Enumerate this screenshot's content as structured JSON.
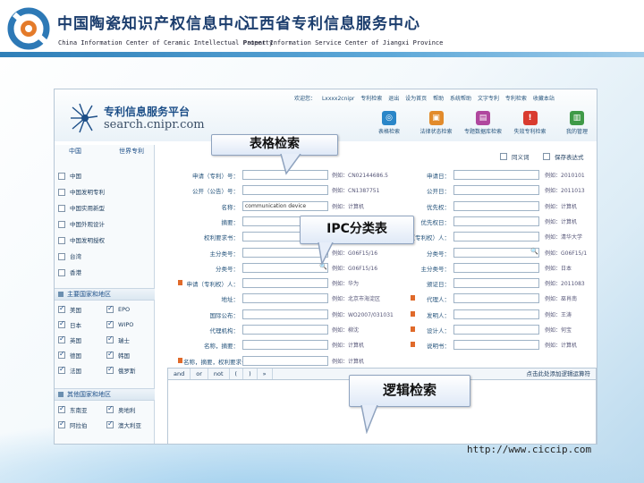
{
  "header": {
    "org1_cn": "中国陶瓷知识产权信息中心",
    "org1_en": "China Information Center of Ceramic Intellectual Property",
    "org2_cn": "江西省专利信息服务中心",
    "org2_en": "Patent Information Service Center of Jiangxi Province"
  },
  "site": {
    "title": "专利信息服务平台",
    "url": "search.cnipr.com",
    "top_links": [
      "欢迎您：",
      "Lxxxx2cnipr",
      "专利检索",
      "退出",
      "设为首页",
      "帮助",
      "系统帮助",
      "文字专利",
      "专利检索",
      "收藏本站"
    ],
    "tools": [
      {
        "label": "表格检索",
        "color": "#2a86c8",
        "glyph": "◎"
      },
      {
        "label": "法律状态检索",
        "color": "#e28b2c",
        "glyph": "▣"
      },
      {
        "label": "专题数据库检索",
        "color": "#b0479e",
        "glyph": "▤"
      },
      {
        "label": "失效专利检索",
        "color": "#d93b2f",
        "glyph": "!"
      },
      {
        "label": "我的管理",
        "color": "#3f9a48",
        "glyph": "▥"
      }
    ]
  },
  "left_panel": {
    "tab1": "中国",
    "tab2": "世界专利",
    "cn_dbs": [
      {
        "label": "中国",
        "checked": false
      },
      {
        "label": "中国发明专利",
        "checked": false
      },
      {
        "label": "中国实用新型",
        "checked": false
      },
      {
        "label": "中国外观设计",
        "checked": false
      },
      {
        "label": "中国发明授权",
        "checked": false
      },
      {
        "label": "台湾",
        "checked": false
      },
      {
        "label": "香港",
        "checked": false
      }
    ],
    "section_major": "主要国家和地区",
    "major_pairs": [
      {
        "a": "美国",
        "b": "EPO",
        "a_on": true,
        "b_on": true
      },
      {
        "a": "日本",
        "b": "WIPO",
        "a_on": true,
        "b_on": true
      },
      {
        "a": "英国",
        "b": "瑞士",
        "a_on": true,
        "b_on": true
      },
      {
        "a": "德国",
        "b": "韩国",
        "a_on": true,
        "b_on": true
      },
      {
        "a": "法国",
        "b": "俄罗斯",
        "a_on": true,
        "b_on": true
      }
    ],
    "section_other": "其他国家和地区",
    "other_pairs": [
      {
        "a": "东南亚",
        "b": "奥地利",
        "a_on": true,
        "b_on": true
      },
      {
        "a": "阿拉伯",
        "b": "澳大利亚",
        "a_on": true,
        "b_on": true
      }
    ]
  },
  "form": {
    "top_checkboxes": [
      "同义词",
      "保存表达式"
    ],
    "left_fields": [
      {
        "label": "申请（专利）号：",
        "hint": "例如：CN02144686.5"
      },
      {
        "label": "公开（公告）号：",
        "hint": "例如：CN1387751"
      },
      {
        "label": "名称：",
        "hint": "例如：计算机",
        "value": "communication device"
      },
      {
        "label": "摘要：",
        "hint": "例如：计算机"
      },
      {
        "label": "权利要求书：",
        "hint": "例如：计算机"
      },
      {
        "label": "主分类号：",
        "hint": "例如：G06F15/16"
      },
      {
        "label": "分类号：",
        "hint": "例如：G06F15/16"
      },
      {
        "label": "申请（专利权）人：",
        "hint": "例如：华为"
      },
      {
        "label": "地址：",
        "hint": "例如：北京市海淀区"
      },
      {
        "label": "国际公布：",
        "hint": "例如：WO2007/031031"
      },
      {
        "label": "代理机构：",
        "hint": "例如：柳沈"
      },
      {
        "label": "名称，摘要：",
        "hint": "例如：计算机"
      },
      {
        "label": "名称，摘要，权利要求书：",
        "hint": "例如：计算机"
      }
    ],
    "right_fields": [
      {
        "label": "申请日：",
        "hint": "例如：2010101"
      },
      {
        "label": "公开日：",
        "hint": "例如：2011013"
      },
      {
        "label": "优先权：",
        "hint": "例如：计算机"
      },
      {
        "label": "优先权日：",
        "hint": "例如：计算机"
      },
      {
        "label": "申请（专利权）人：",
        "hint": "例如：清华大学"
      },
      {
        "label": "分类号：",
        "hint": "例如：G06F15/1"
      },
      {
        "label": "主分类号：",
        "hint": "例如：日本"
      },
      {
        "label": "颁证日：",
        "hint": "例如：2011083"
      },
      {
        "label": "代理人：",
        "hint": "例如：巫肖南"
      },
      {
        "label": "发明人：",
        "hint": "例如：王涛"
      },
      {
        "label": "设计人：",
        "hint": "例如：何宝"
      },
      {
        "label": "说明书：",
        "hint": "例如：计算机"
      }
    ],
    "logic_ops": [
      "and",
      "or",
      "not",
      "(",
      ")",
      "»"
    ],
    "logic_right": "点击此处添加逻辑运算符"
  },
  "callouts": {
    "table_search": "表格检索",
    "ipc": "IPC分类表",
    "logic": "逻辑检索"
  },
  "footer_url": "http://www.ciccip.com"
}
